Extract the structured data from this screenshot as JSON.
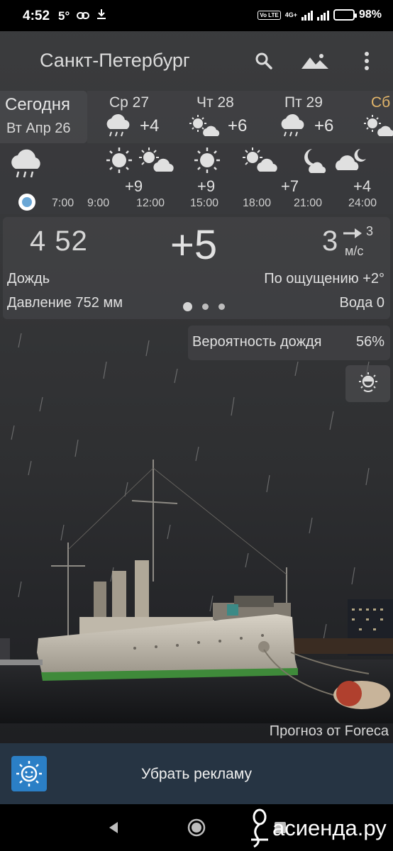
{
  "status_bar": {
    "time": "4:52",
    "temp_indicator": "5°",
    "network": "4G+",
    "volte": "Vo LTE",
    "battery": "98%",
    "battery_level": 0.98
  },
  "header": {
    "city": "Санкт-Петербург",
    "search_icon": "search-icon",
    "landscape_icon": "landscape-icon",
    "menu_icon": "more-vert-icon"
  },
  "days": {
    "today_label": "Сегодня",
    "today_date": "Вт Апр 26",
    "items": [
      {
        "name": "Ср 27",
        "icon": "rain-cloud-icon",
        "temp": "+4"
      },
      {
        "name": "Чт 28",
        "icon": "sun-cloud-icon",
        "temp": "+6"
      },
      {
        "name": "Пт 29",
        "icon": "rain-cloud-icon",
        "temp": "+6"
      },
      {
        "name": "Сб",
        "icon": "sun-cloud-icon",
        "temp": ""
      }
    ],
    "weekend_color": "#e2b56a"
  },
  "hourly": {
    "now_icon": "rain-cloud-icon",
    "items": [
      {
        "time": "7:00",
        "icon": "",
        "temp": ""
      },
      {
        "time": "9:00",
        "icon": "sun-icon",
        "temp": ""
      },
      {
        "time": "12:00",
        "icon": "sun-cloud-icon",
        "temp": "+9"
      },
      {
        "time": "15:00",
        "icon": "sun-icon",
        "temp": "+9"
      },
      {
        "time": "18:00",
        "icon": "sun-cloud-icon",
        "temp": ""
      },
      {
        "time": "21:00",
        "icon": "moon-cloud-icon",
        "temp": "+7"
      },
      {
        "time": "24:00",
        "icon": "moon-cloud-icon",
        "temp": "+4"
      }
    ]
  },
  "current": {
    "time": "4 52",
    "temp": "+5",
    "wind_speed": "3",
    "wind_dir_value": "3",
    "wind_unit": "м/с",
    "condition": "Дождь",
    "feels_like": "По ощущению +2°",
    "pressure": "Давление 752 мм",
    "water": "Вода 0"
  },
  "rain_probability": {
    "label": "Вероятность дождя",
    "value": "56%"
  },
  "credit": "Прогноз от Foreca",
  "ad": {
    "label": "Убрать рекламу"
  },
  "watermark": "асиенда.ру"
}
